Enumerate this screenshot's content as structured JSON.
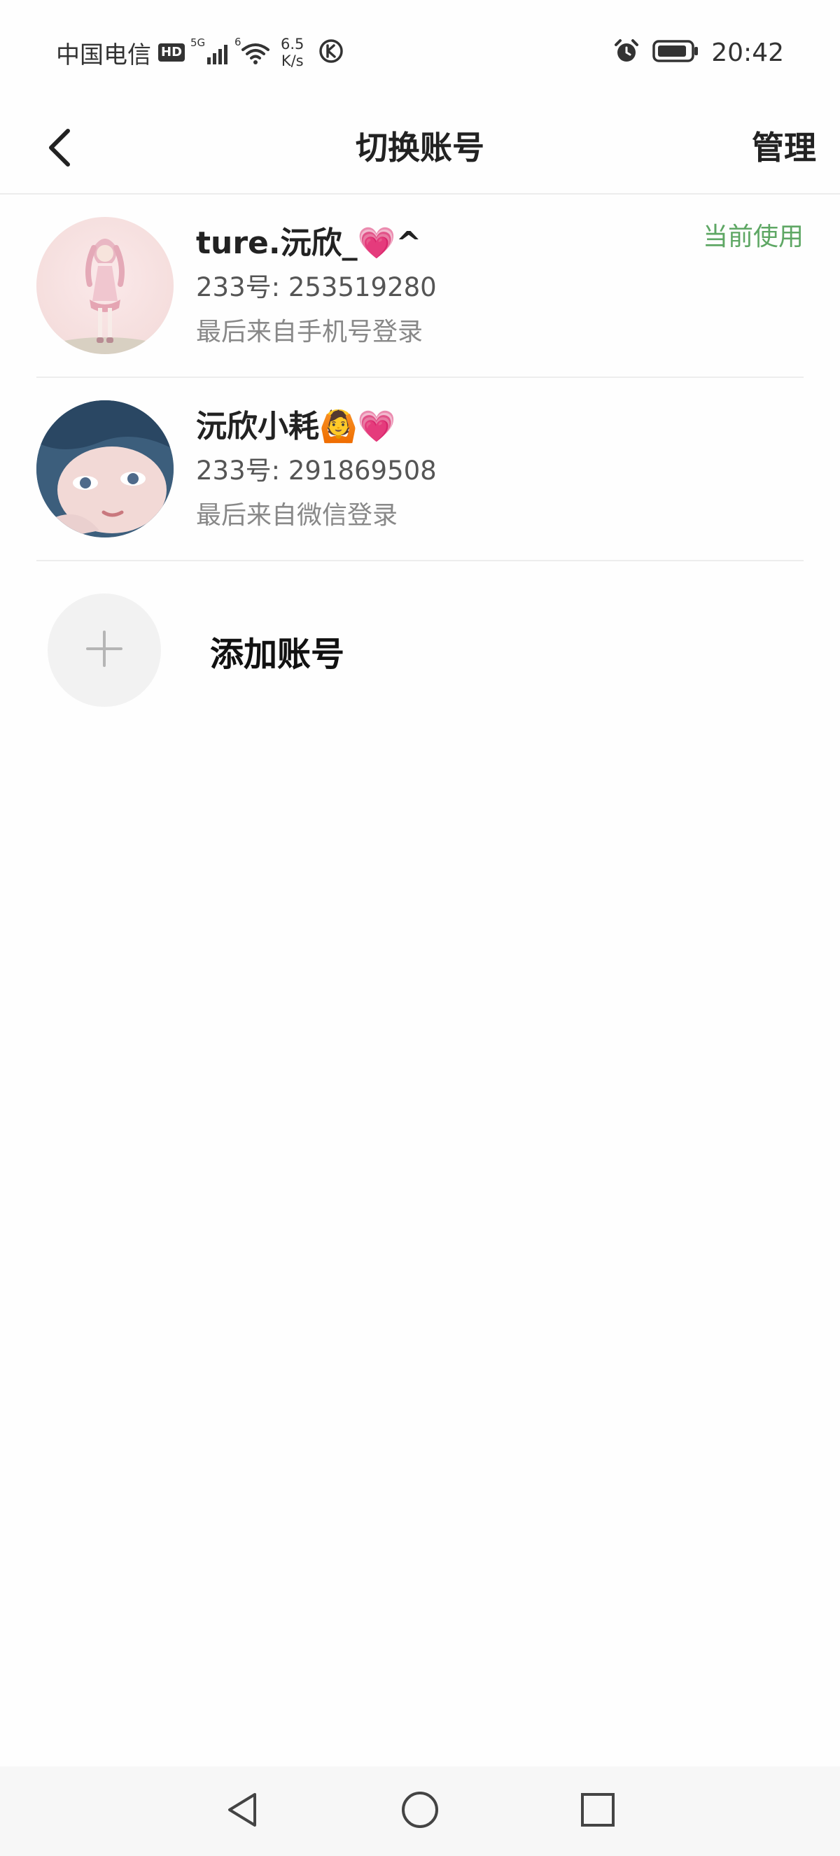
{
  "status_bar": {
    "carrier": "中国电信",
    "hd_badge": "HD",
    "net_speed_value": "6.5",
    "net_speed_unit": "K/s",
    "time": "20:42",
    "signal_label": "5G",
    "wifi_label": "6"
  },
  "header": {
    "title": "切换账号",
    "manage_label": "管理"
  },
  "accounts": [
    {
      "name": "ture.沅欣_💗^",
      "id_text": "233号: 253519280",
      "login_text": "最后来自手机号登录",
      "current_label": "当前使用"
    },
    {
      "name": "沅欣小耗🙆💗",
      "id_text": "233号: 291869508",
      "login_text": "最后来自微信登录"
    }
  ],
  "add_account": {
    "label": "添加账号"
  },
  "colors": {
    "accent_green": "#5ea764",
    "text_primary": "#222222",
    "text_secondary": "#888888"
  },
  "icons": {
    "back": "chevron-left-icon",
    "add": "plus-icon",
    "nav_back": "triangle-back-icon",
    "nav_home": "circle-home-icon",
    "nav_recent": "square-recent-icon"
  }
}
